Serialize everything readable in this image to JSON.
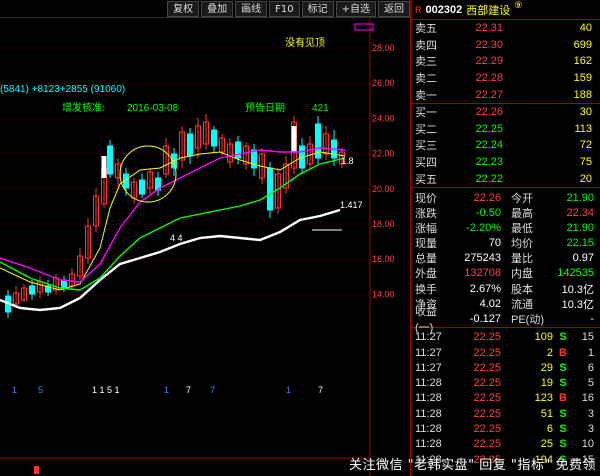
{
  "toolbar": {
    "buttons": [
      "复权",
      "叠加",
      "画线",
      "F10",
      "标记",
      "+自选",
      "返回"
    ]
  },
  "stock": {
    "flag": "R",
    "code": "002302",
    "name": "西部建设",
    "sup": "⑨"
  },
  "chart": {
    "indicator_text": "(5841)  +8123+2855  (91060)",
    "annotation_zfhz": "增发核准:",
    "annotation_date": "2016-03-08",
    "annotation_ycrq": "预告日期",
    "annotation_num": "421",
    "annotation_mfxy": "没有见顶",
    "last_ma_label": "1.8",
    "last_price_label": "1.417",
    "mid_label": "4 4",
    "bottom_markers": [
      "1",
      "5",
      "1 1 5 1",
      "1",
      "7",
      "7",
      "1",
      "7"
    ],
    "axis_ticks": [
      "28.00",
      "26.00",
      "24.00",
      "22.00",
      "20.00",
      "18.00",
      "16.00",
      "14.00"
    ],
    "colors": {
      "up": "#ff3333",
      "down": "#00ffff",
      "ma1": "#ffffff",
      "ma2": "#ffff00",
      "ma3": "#ff00ff",
      "ma4": "#00ff00",
      "grid": "#a00000"
    }
  },
  "order_book": {
    "asks": [
      {
        "label": "卖五",
        "price": "22.31",
        "vol": "40"
      },
      {
        "label": "卖四",
        "price": "22.30",
        "vol": "699"
      },
      {
        "label": "卖三",
        "price": "22.29",
        "vol": "162"
      },
      {
        "label": "卖二",
        "price": "22.28",
        "vol": "159"
      },
      {
        "label": "卖一",
        "price": "22.27",
        "vol": "188"
      }
    ],
    "bids": [
      {
        "label": "买一",
        "price": "22.26",
        "vol": "30"
      },
      {
        "label": "买二",
        "price": "22.25",
        "vol": "113"
      },
      {
        "label": "买三",
        "price": "22.24",
        "vol": "72"
      },
      {
        "label": "买四",
        "price": "22.23",
        "vol": "75"
      },
      {
        "label": "买五",
        "price": "22.22",
        "vol": "20"
      }
    ]
  },
  "stats": [
    {
      "l1": "现价",
      "v1": "22.26",
      "c1": "",
      "l2": "今开",
      "v2": "21.90",
      "c2": "g"
    },
    {
      "l1": "涨跌",
      "v1": "-0.50",
      "c1": "g",
      "l2": "最高",
      "v2": "22.34",
      "c2": ""
    },
    {
      "l1": "涨幅",
      "v1": "-2.20%",
      "c1": "g",
      "l2": "最低",
      "v2": "21.90",
      "c2": "g"
    },
    {
      "l1": "现量",
      "v1": "70",
      "c1": "w",
      "l2": "均价",
      "v2": "22.15",
      "c2": "g"
    },
    {
      "l1": "总量",
      "v1": "275243",
      "c1": "w",
      "l2": "量比",
      "v2": "0.97",
      "c2": "w"
    },
    {
      "l1": "外盘",
      "v1": "132708",
      "c1": "",
      "l2": "内盘",
      "v2": "142535",
      "c2": "g"
    },
    {
      "l1": "换手",
      "v1": "2.67%",
      "c1": "w",
      "l2": "股本",
      "v2": "10.3亿",
      "c2": "w"
    },
    {
      "l1": "净资",
      "v1": "4.02",
      "c1": "w",
      "l2": "流通",
      "v2": "10.3亿",
      "c2": "w"
    },
    {
      "l1": "收益(一)",
      "v1": "-0.127",
      "c1": "w",
      "l2": "PE(动)",
      "v2": "-",
      "c2": "w"
    }
  ],
  "ticks": [
    {
      "time": "11:27",
      "price": "22.25",
      "vol": "109",
      "dir": "S",
      "n": "15"
    },
    {
      "time": "11:27",
      "price": "22.25",
      "vol": "2",
      "dir": "B",
      "n": "1"
    },
    {
      "time": "11:27",
      "price": "22.25",
      "vol": "29",
      "dir": "S",
      "n": "6"
    },
    {
      "time": "11:28",
      "price": "22.25",
      "vol": "19",
      "dir": "S",
      "n": "5"
    },
    {
      "time": "11:28",
      "price": "22.25",
      "vol": "123",
      "dir": "B",
      "n": "16"
    },
    {
      "time": "11:28",
      "price": "22.25",
      "vol": "51",
      "dir": "S",
      "n": "3"
    },
    {
      "time": "11:28",
      "price": "22.25",
      "vol": "6",
      "dir": "S",
      "n": "3"
    },
    {
      "time": "11:28",
      "price": "22.25",
      "vol": "25",
      "dir": "S",
      "n": "10"
    },
    {
      "time": "11:28",
      "price": "22.25",
      "vol": "194",
      "dir": "S",
      "n": "15"
    }
  ],
  "watermark": "关注微信 \"老韩实盘\" 回复 \"指标\" 免费领"
}
